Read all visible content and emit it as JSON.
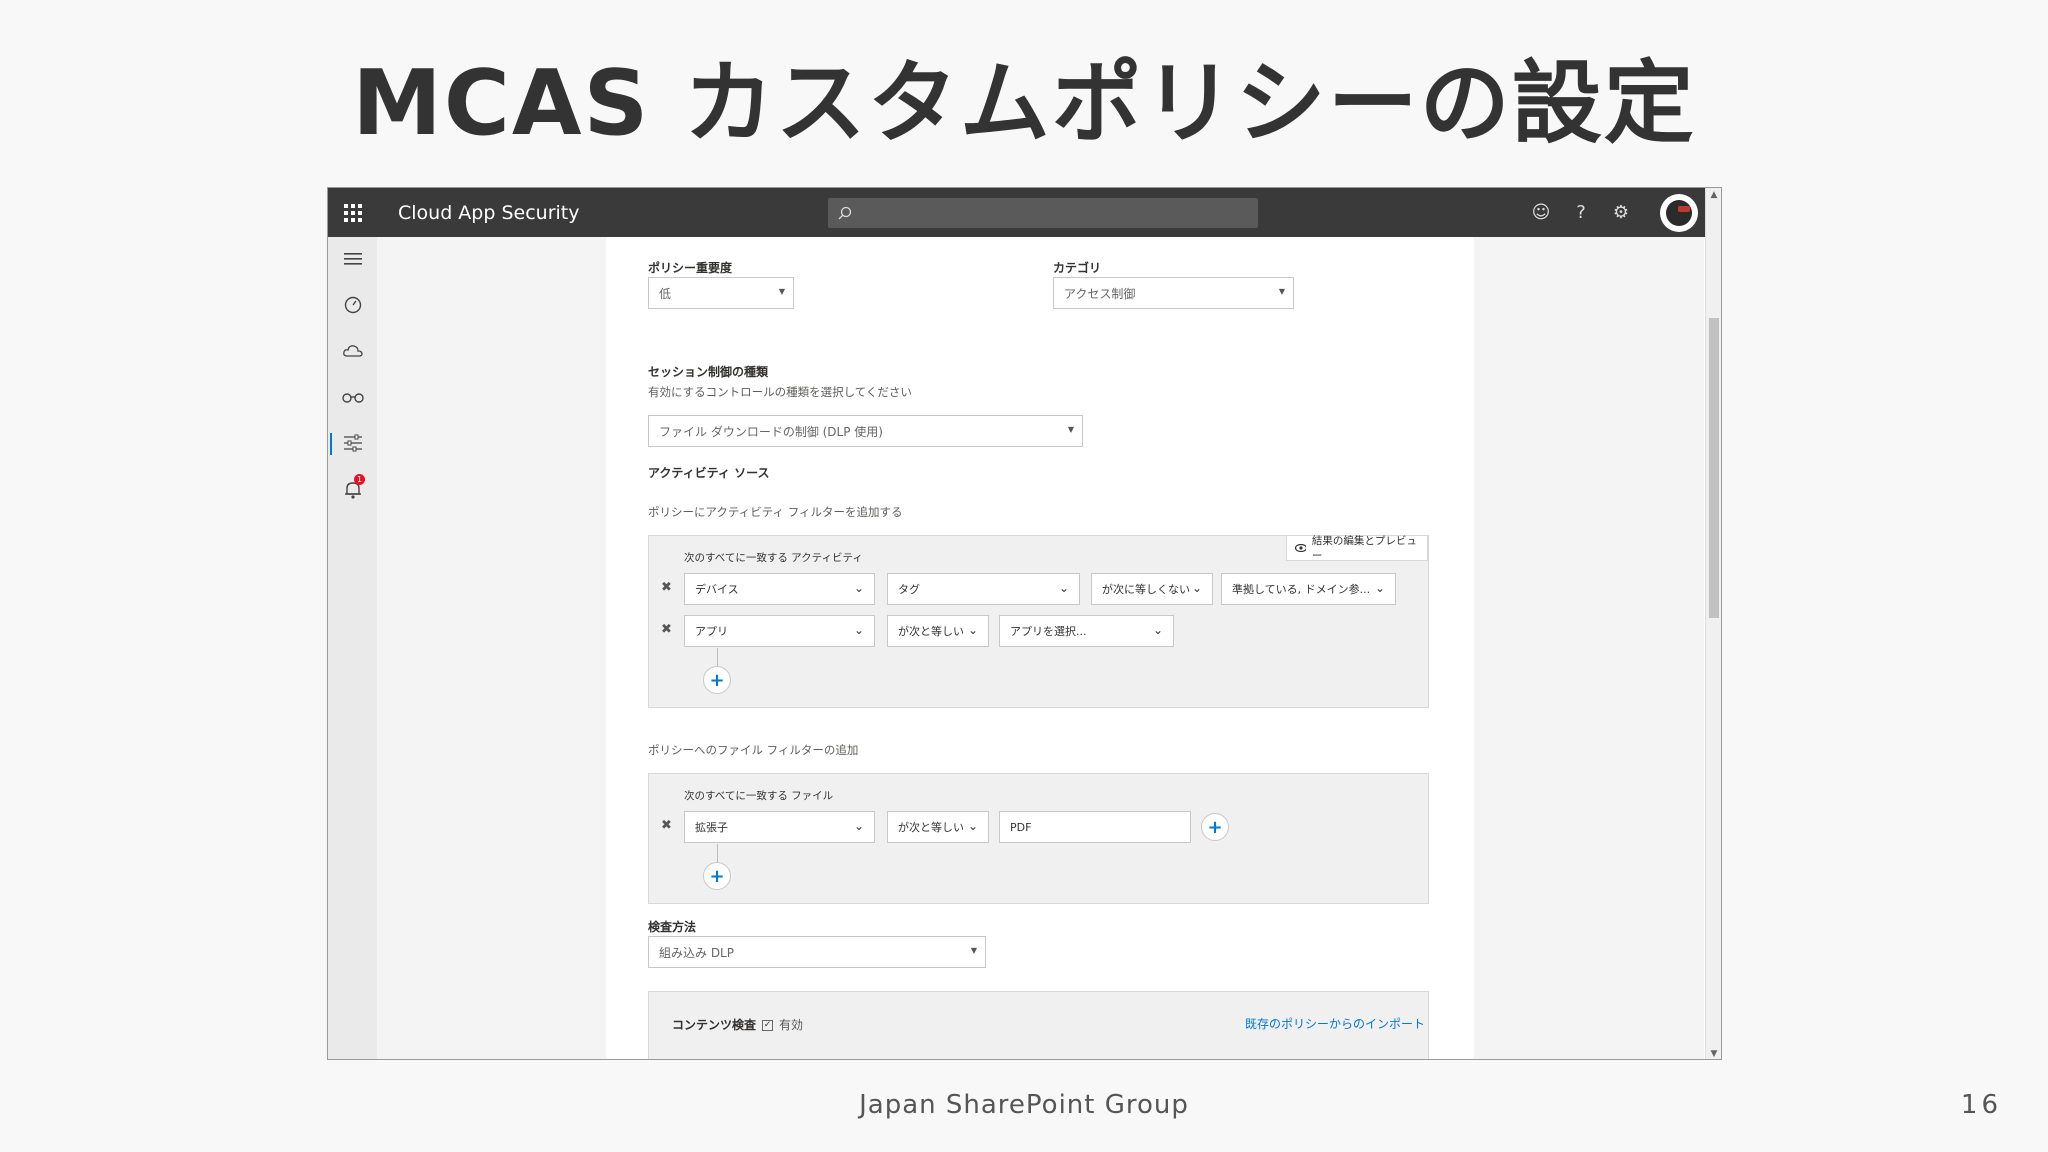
{
  "slide": {
    "title": "MCAS カスタムポリシーの設定",
    "footer": "Japan SharePoint Group",
    "page_number": "16"
  },
  "app": {
    "title": "Cloud App Security",
    "search_placeholder": "",
    "top_icons": [
      "smiley-icon",
      "help-icon",
      "settings-icon"
    ],
    "nav_icons": [
      "menu-icon",
      "dashboard-icon",
      "cloud-icon",
      "glasses-icon",
      "control-icon",
      "alerts-icon"
    ],
    "alerts_count": "1"
  },
  "form": {
    "severity": {
      "label": "ポリシー重要度",
      "value": "低"
    },
    "category": {
      "label": "カテゴリ",
      "value": "アクセス制御"
    },
    "session_control": {
      "label": "セッション制御の種類",
      "hint": "有効にするコントロールの種類を選択してください",
      "value": "ファイル ダウンロードの制御 (DLP 使用)"
    },
    "activity_source": {
      "label": "アクティビティ ソース",
      "hint": "ポリシーにアクティビティ フィルターを追加する",
      "box_title": "次のすべてに一致する アクティビティ",
      "preview_label": "結果の編集とプレビュー",
      "rows": [
        {
          "field": "デバイス",
          "field2": "タグ",
          "operator": "が次に等しくない",
          "value": "準拠している, ドメイン参..."
        },
        {
          "field": "アプリ",
          "operator": "が次と等しい",
          "value": "アプリを選択..."
        }
      ]
    },
    "file_filter": {
      "hint": "ポリシーへのファイル フィルターの追加",
      "box_title": "次のすべてに一致する ファイル",
      "row": {
        "field": "拡張子",
        "operator": "が次と等しい",
        "value": "PDF"
      }
    },
    "inspection": {
      "label": "検査方法",
      "value": "組み込み DLP"
    },
    "content_inspection": {
      "label": "コンテンツ検査",
      "checkbox_label": "有効",
      "import_link": "既存のポリシーからのインポート"
    }
  }
}
